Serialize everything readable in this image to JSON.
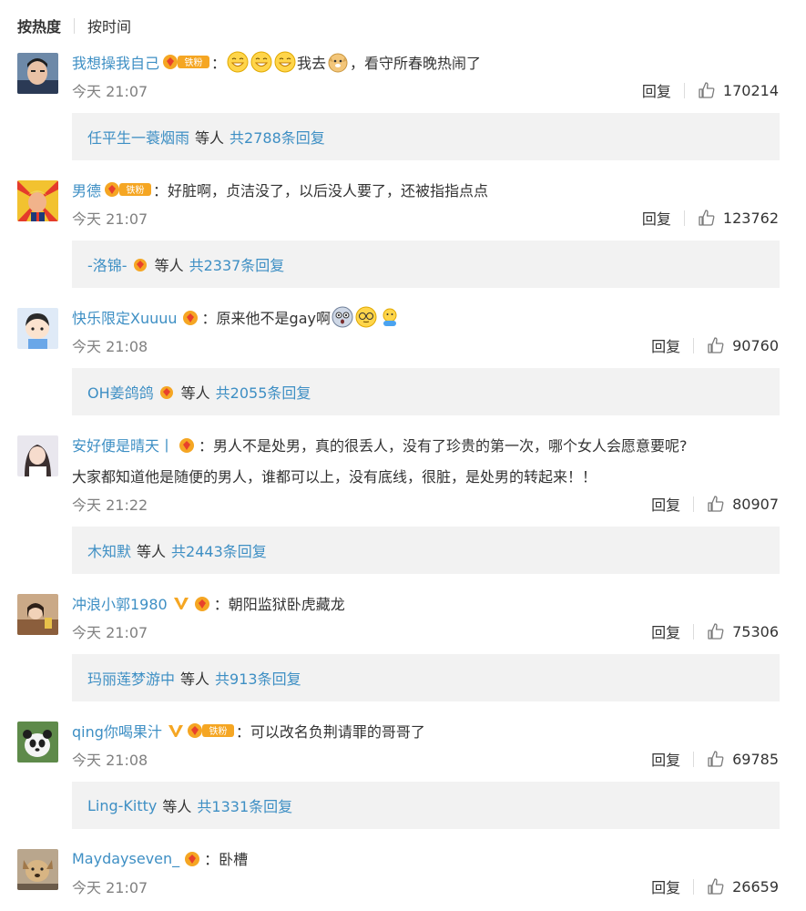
{
  "tabs": {
    "hot": "按热度",
    "time": "按时间"
  },
  "comments": [
    {
      "user": "我想操我自己",
      "fan_badge": "铁粉",
      "vip": false,
      "text_before": "",
      "text_mid": "我去",
      "text_after": "，看守所春晚热闹了",
      "emojis_a": [
        "grin-emoji",
        "grin-emoji",
        "grin-emoji"
      ],
      "emojis_b": [
        "doge-emoji"
      ],
      "time": "今天 21:07",
      "reply": "回复",
      "likes": "170214",
      "sub_name": "任平生一蓑烟雨",
      "sub_etc": "等人",
      "sub_count": "共2788条回复",
      "sub_badge": false
    },
    {
      "user": "男德",
      "fan_badge": "铁粉",
      "vip": false,
      "text": "好脏啊，贞洁没了，以后没人要了，还被指指点点",
      "time": "今天 21:07",
      "reply": "回复",
      "likes": "123762",
      "sub_name": "-洛锦-",
      "sub_etc": "等人",
      "sub_count": "共2337条回复",
      "sub_badge": true
    },
    {
      "user": "快乐限定Xuuuu",
      "fan_badge": "",
      "vip": false,
      "text": "原来他不是gay啊",
      "time": "今天 21:08",
      "reply": "回复",
      "likes": "90760",
      "sub_name": "OH姜鸽鸽",
      "sub_etc": "等人",
      "sub_count": "共2055条回复",
      "sub_badge": true
    },
    {
      "user": "安好便是晴天丨",
      "fan_badge": "",
      "vip": false,
      "text": "男人不是处男，真的很丢人，没有了珍贵的第一次，哪个女人会愿意要呢?",
      "text2": "大家都知道他是随便的男人，谁都可以上，没有底线，很脏，是处男的转起来！！",
      "time": "今天 21:22",
      "reply": "回复",
      "likes": "80907",
      "sub_name": "木知默",
      "sub_etc": "等人",
      "sub_count": "共2443条回复",
      "sub_badge": false
    },
    {
      "user": "冲浪小郭1980",
      "fan_badge": "",
      "vip": true,
      "text": "朝阳监狱卧虎藏龙",
      "time": "今天 21:07",
      "reply": "回复",
      "likes": "75306",
      "sub_name": "玛丽莲梦游中",
      "sub_etc": "等人",
      "sub_count": "共913条回复",
      "sub_badge": false
    },
    {
      "user": "qing你喝果汁",
      "fan_badge": "铁粉",
      "vip": true,
      "text": "可以改名负荆请罪的哥哥了",
      "time": "今天 21:08",
      "reply": "回复",
      "likes": "69785",
      "sub_name": "Ling-Kitty",
      "sub_etc": "等人",
      "sub_count": "共1331条回复",
      "sub_badge": false
    },
    {
      "user": "Maydayseven_",
      "fan_badge": "",
      "vip": false,
      "text": "卧槽",
      "time": "今天 21:07",
      "reply": "回复",
      "likes": "26659"
    }
  ],
  "colors": {
    "username": "#eb7350",
    "link": "#3e8fc4",
    "subbox_bg": "#f2f2f2"
  }
}
